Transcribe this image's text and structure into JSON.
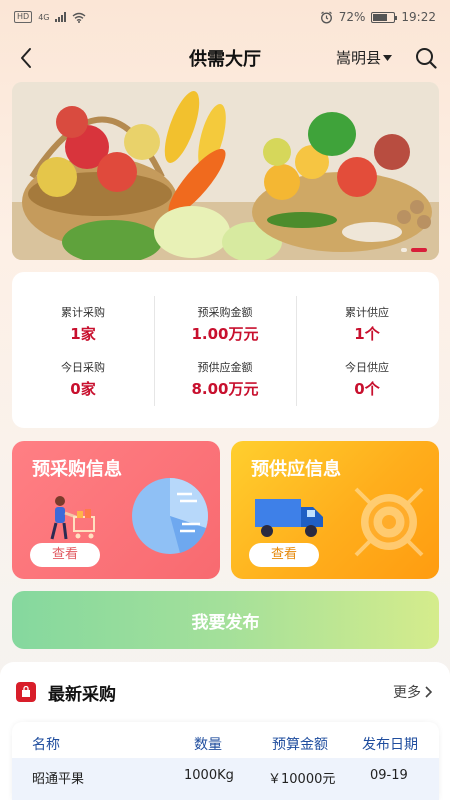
{
  "statusbar": {
    "left_badges": [
      "HD",
      "4G"
    ],
    "battery_percent": "72%",
    "time": "19:22",
    "battery_level": 0.72
  },
  "navbar": {
    "title": "供需大厅",
    "region": "嵩明县",
    "icons": {
      "back": "chevron-left-icon",
      "search": "search-icon",
      "region_dropdown": "caret-down-icon"
    }
  },
  "banner": {
    "slide_count": 2,
    "active_slide": 1
  },
  "stats": {
    "cumulative_purchase": {
      "label": "累计采购",
      "value": "1家"
    },
    "pre_purchase_amount": {
      "label": "预采购金额",
      "value": "1.00万元"
    },
    "cumulative_supply": {
      "label": "累计供应",
      "value": "1个"
    },
    "today_purchase": {
      "label": "今日采购",
      "value": "0家"
    },
    "pre_supply_amount": {
      "label": "预供应金额",
      "value": "8.00万元"
    },
    "today_supply": {
      "label": "今日供应",
      "value": "0个"
    }
  },
  "cards": {
    "purchase": {
      "title": "预采购信息",
      "button": "查看"
    },
    "supply": {
      "title": "预供应信息",
      "button": "查看"
    }
  },
  "publish_button": "我要发布",
  "latest": {
    "title": "最新采购",
    "more": "更多",
    "columns": [
      "名称",
      "数量",
      "预算金额",
      "发布日期"
    ],
    "rows": [
      {
        "name": "昭通平果",
        "quantity": "1000Kg",
        "budget": "￥10000元",
        "date": "09-19"
      }
    ]
  },
  "colors": {
    "accent_red": "#c8102e",
    "purchase_card": "#f86a70",
    "supply_card": "#ffae1c",
    "publish_green": "#85d89e",
    "table_header_blue": "#1f4d9e"
  }
}
